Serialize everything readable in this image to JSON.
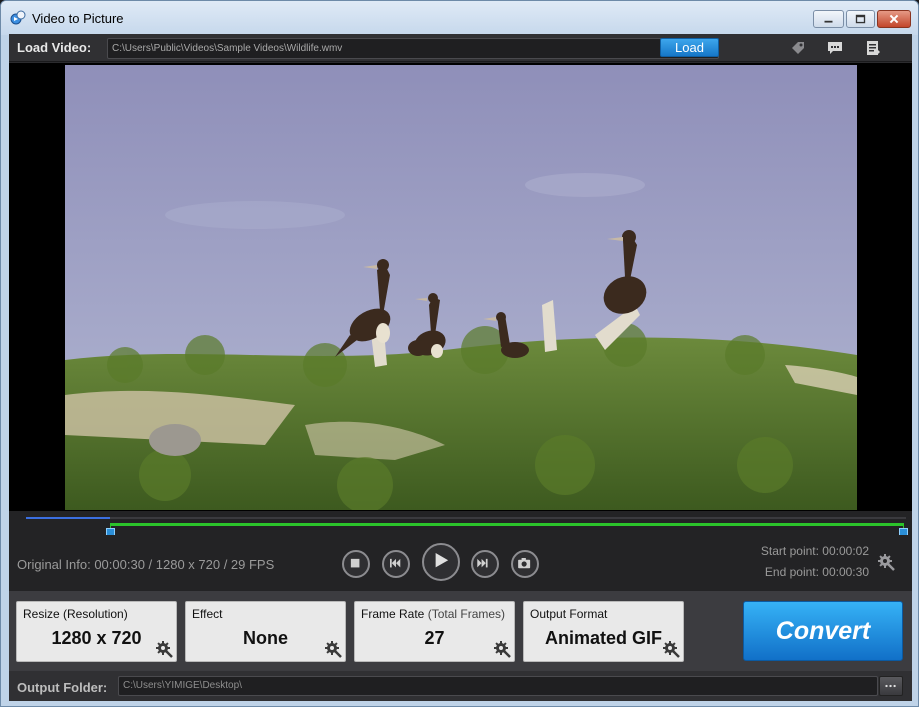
{
  "window": {
    "title": "Video to Picture",
    "icon": "app-icon",
    "controls": [
      "minimize-icon",
      "maximize-icon",
      "close-icon"
    ]
  },
  "load_bar": {
    "label": "Load Video:",
    "path": "C:\\Users\\Public\\Videos\\Sample Videos\\Wildlife.wmv",
    "load_button": "Load",
    "tool_icons": [
      "tag-icon",
      "chat-icon",
      "list-icon"
    ]
  },
  "timeline": {
    "played_fraction": 0.095,
    "selection_start_fraction": 0.095,
    "selection_end_fraction": 1.0
  },
  "playback": {
    "original_info": "Original Info: 00:00:30 / 1280 x 720 / 29 FPS",
    "buttons": [
      "stop-icon",
      "previous-frame-icon",
      "play-icon",
      "next-frame-icon",
      "camera-icon"
    ],
    "start_point": "Start point: 00:00:02",
    "end_point": "End point: 00:00:30"
  },
  "options": {
    "resize": {
      "label": "Resize (Resolution)",
      "value": "1280 x 720"
    },
    "effect": {
      "label": "Effect",
      "value": "None"
    },
    "frame_rate": {
      "label": "Frame Rate",
      "sub_label": "(Total Frames)",
      "value": "27"
    },
    "output_format": {
      "label": "Output Format",
      "value": "Animated GIF"
    },
    "convert_button": "Convert"
  },
  "output": {
    "label": "Output Folder:",
    "path": "C:\\Users\\YIMIGE\\Desktop\\",
    "browse_button": "..."
  },
  "colors": {
    "accent_blue": "#1a86d8",
    "selection_green": "#2bc32b",
    "played_blue": "#3b6fe0",
    "panel_dark": "#2b2b2e"
  }
}
